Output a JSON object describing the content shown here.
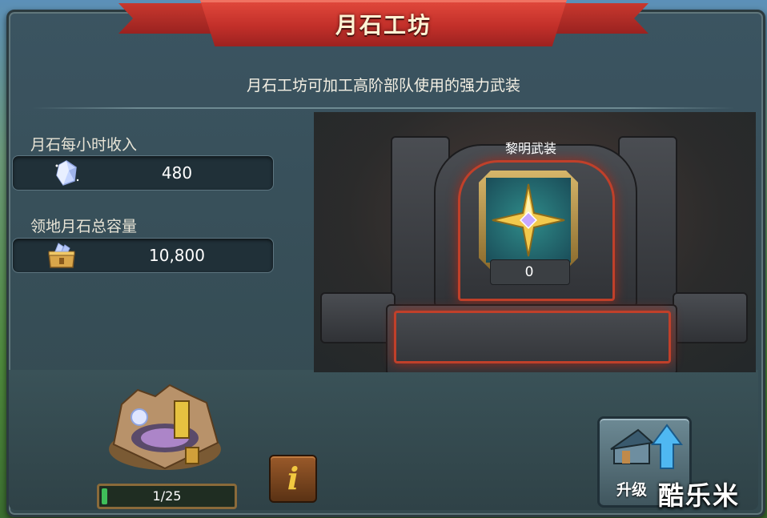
{
  "header": {
    "title": "月石工坊"
  },
  "subtitle": "月石工坊可加工高阶部队使用的强力武装",
  "stats": {
    "hourly_income_label": "月石每小时收入",
    "hourly_income_value": "480",
    "capacity_label": "领地月石总容量",
    "capacity_value": "10,800"
  },
  "item": {
    "title": "黎明武装",
    "count": "0"
  },
  "building": {
    "level_text": "1/25",
    "level_fraction": 0.04
  },
  "buttons": {
    "upgrade_label": "升级",
    "info_label": "i"
  },
  "watermark": "酷乐米",
  "icons": {
    "moonstone": "moonstone-gem-icon",
    "chest": "moonstone-chest-icon",
    "armament": "dawn-armament-icon",
    "upgrade": "upgrade-arrow-icon"
  },
  "colors": {
    "banner": "#c3302a",
    "panel": "#33494f",
    "progress": "#3fbf5a",
    "throne_glow": "#c0402a"
  }
}
